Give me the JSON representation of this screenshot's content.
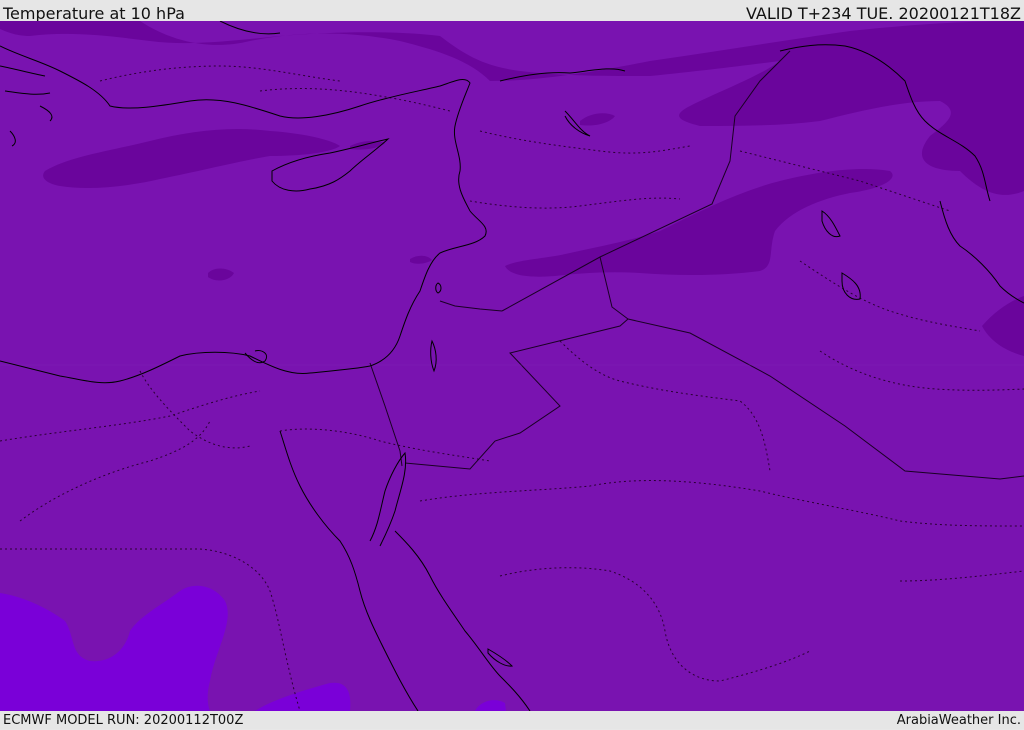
{
  "header": {
    "title": "Temperature at 10 hPa",
    "valid_time": "VALID T+234 TUE. 20200121T18Z"
  },
  "footer": {
    "model_run": "ECMWF MODEL RUN: 20200112T00Z",
    "credit": "ArabiaWeather Inc."
  },
  "colors": {
    "base_fill": "#7913b0",
    "cold_band": "#6a059c",
    "warm_patch": "#7a00d8",
    "coast": "#000000",
    "border": "#2a0033"
  },
  "map": {
    "variable": "temperature",
    "level": "10 hPa"
  }
}
